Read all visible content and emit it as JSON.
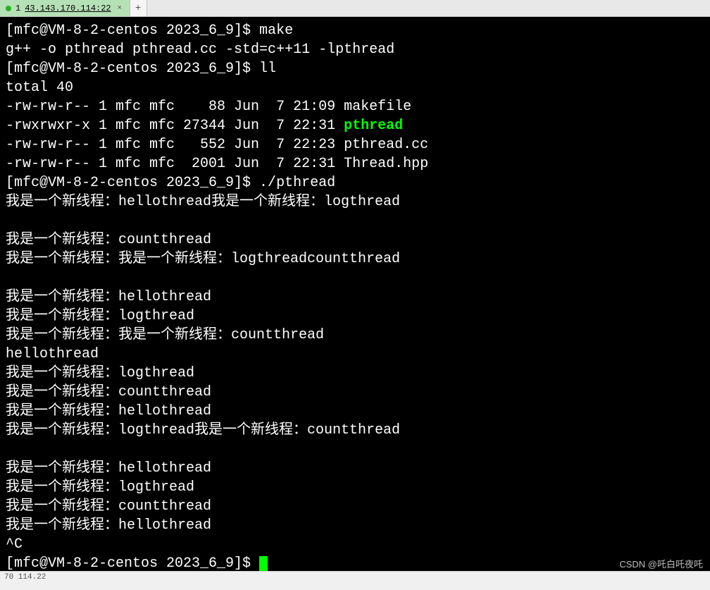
{
  "tab": {
    "index_marker": "1",
    "label": "43.143.170.114:22",
    "close": "×"
  },
  "addtab": "+",
  "terminal": {
    "lines": [
      {
        "spans": [
          {
            "t": "[mfc@VM-8-2-centos 2023_6_9]$ make"
          }
        ]
      },
      {
        "spans": [
          {
            "t": "g++ -o pthread pthread.cc -std=c++11 -lpthread"
          }
        ]
      },
      {
        "spans": [
          {
            "t": "[mfc@VM-8-2-centos 2023_6_9]$ ll"
          }
        ]
      },
      {
        "spans": [
          {
            "t": "total 40"
          }
        ]
      },
      {
        "spans": [
          {
            "t": "-rw-rw-r-- 1 mfc mfc    88 Jun  7 21:09 makefile"
          }
        ]
      },
      {
        "spans": [
          {
            "t": "-rwxrwxr-x 1 mfc mfc 27344 Jun  7 22:31 "
          },
          {
            "t": "pthread",
            "c": "exec"
          }
        ]
      },
      {
        "spans": [
          {
            "t": "-rw-rw-r-- 1 mfc mfc   552 Jun  7 22:23 pthread.cc"
          }
        ]
      },
      {
        "spans": [
          {
            "t": "-rw-rw-r-- 1 mfc mfc  2001 Jun  7 22:31 Thread.hpp"
          }
        ]
      },
      {
        "spans": [
          {
            "t": "[mfc@VM-8-2-centos 2023_6_9]$ ./pthread"
          }
        ]
      },
      {
        "spans": [
          {
            "t": "我是一个新线程：hellothread我是一个新线程：logthread"
          }
        ]
      },
      {
        "spans": [
          {
            "t": ""
          }
        ]
      },
      {
        "spans": [
          {
            "t": "我是一个新线程：countthread"
          }
        ]
      },
      {
        "spans": [
          {
            "t": "我是一个新线程：我是一个新线程：logthreadcountthread"
          }
        ]
      },
      {
        "spans": [
          {
            "t": ""
          }
        ]
      },
      {
        "spans": [
          {
            "t": "我是一个新线程：hellothread"
          }
        ]
      },
      {
        "spans": [
          {
            "t": "我是一个新线程：logthread"
          }
        ]
      },
      {
        "spans": [
          {
            "t": "我是一个新线程：我是一个新线程：countthread"
          }
        ]
      },
      {
        "spans": [
          {
            "t": "hellothread"
          }
        ]
      },
      {
        "spans": [
          {
            "t": "我是一个新线程：logthread"
          }
        ]
      },
      {
        "spans": [
          {
            "t": "我是一个新线程：countthread"
          }
        ]
      },
      {
        "spans": [
          {
            "t": "我是一个新线程：hellothread"
          }
        ]
      },
      {
        "spans": [
          {
            "t": "我是一个新线程：logthread我是一个新线程：countthread"
          }
        ]
      },
      {
        "spans": [
          {
            "t": ""
          }
        ]
      },
      {
        "spans": [
          {
            "t": "我是一个新线程：hellothread"
          }
        ]
      },
      {
        "spans": [
          {
            "t": "我是一个新线程：logthread"
          }
        ]
      },
      {
        "spans": [
          {
            "t": "我是一个新线程：countthread"
          }
        ]
      },
      {
        "spans": [
          {
            "t": "我是一个新线程：hellothread"
          }
        ]
      },
      {
        "spans": [
          {
            "t": "^C"
          }
        ]
      },
      {
        "spans": [
          {
            "t": "[mfc@VM-8-2-centos 2023_6_9]$ "
          }
        ],
        "cursor": true
      }
    ]
  },
  "status": "70 114.22",
  "watermark": "CSDN @吒白吒夜吒"
}
